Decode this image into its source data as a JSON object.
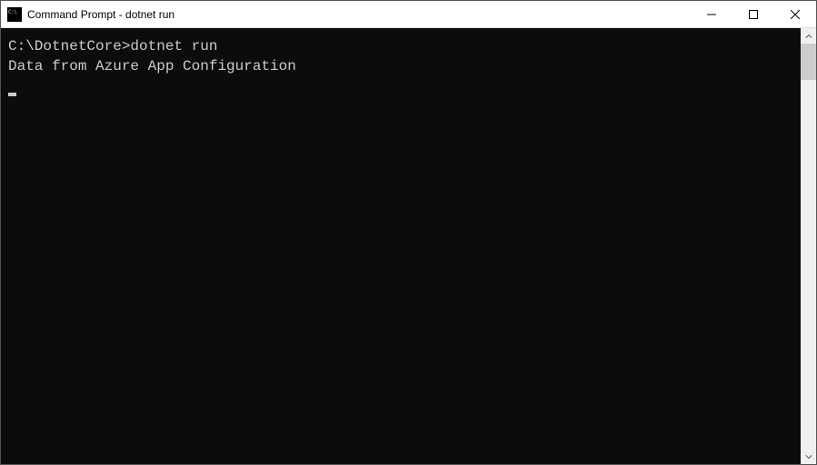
{
  "window": {
    "title": "Command Prompt - dotnet  run"
  },
  "terminal": {
    "prompt": "C:\\DotnetCore>",
    "command": "dotnet run",
    "output_line1": "Data from Azure App Configuration"
  }
}
